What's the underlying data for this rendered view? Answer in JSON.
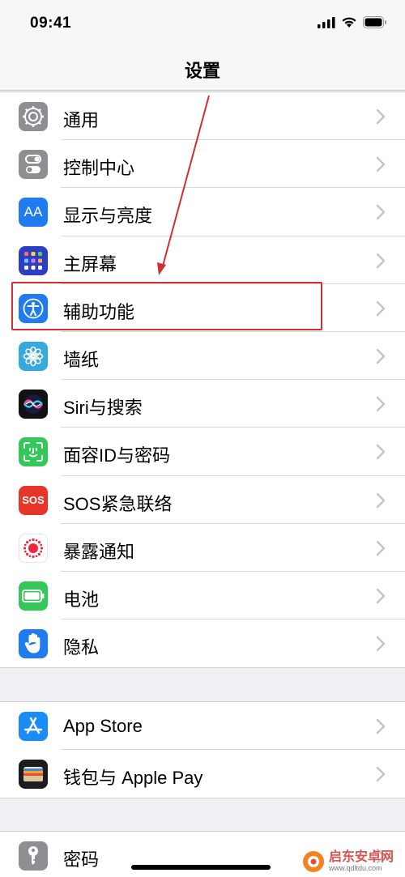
{
  "status": {
    "time": "09:41"
  },
  "nav": {
    "title": "设置"
  },
  "groups": [
    {
      "items": [
        {
          "label": "通用",
          "icon": "gear-icon",
          "color": "#8e8e93"
        },
        {
          "label": "控制中心",
          "icon": "toggles-icon",
          "color": "#8e8e93"
        },
        {
          "label": "显示与亮度",
          "icon": "text-size-icon",
          "color": "#1e7cf0",
          "icon_text": "AA"
        },
        {
          "label": "主屏幕",
          "icon": "home-grid-icon",
          "color": "#3350d0"
        },
        {
          "label": "辅助功能",
          "icon": "accessibility-icon",
          "color": "#1e7cf0"
        },
        {
          "label": "墙纸",
          "icon": "flower-icon",
          "color": "#36aadc"
        },
        {
          "label": "Siri与搜索",
          "icon": "siri-icon",
          "color": "#111"
        },
        {
          "label": "面容ID与密码",
          "icon": "face-id-icon",
          "color": "#34c759"
        },
        {
          "label": "SOS紧急联络",
          "icon": "sos-icon",
          "color": "#e8352b",
          "icon_text": "SOS"
        },
        {
          "label": "暴露通知",
          "icon": "exposure-icon",
          "color": "#ffffff"
        },
        {
          "label": "电池",
          "icon": "battery-icon",
          "color": "#34c759"
        },
        {
          "label": "隐私",
          "icon": "hand-icon",
          "color": "#1e7cf0"
        }
      ]
    },
    {
      "items": [
        {
          "label": "App Store",
          "icon": "app-store-icon",
          "color": "#1a8cf5"
        },
        {
          "label": "钱包与 Apple Pay",
          "icon": "wallet-icon",
          "color": "#1c1c1e"
        }
      ]
    },
    {
      "items": [
        {
          "label": "密码",
          "icon": "key-icon",
          "color": "#8e8e93"
        }
      ]
    }
  ],
  "watermark": {
    "name": "启东安卓网",
    "url": "www.qdltdu.com"
  },
  "accent": "#d32f2f"
}
